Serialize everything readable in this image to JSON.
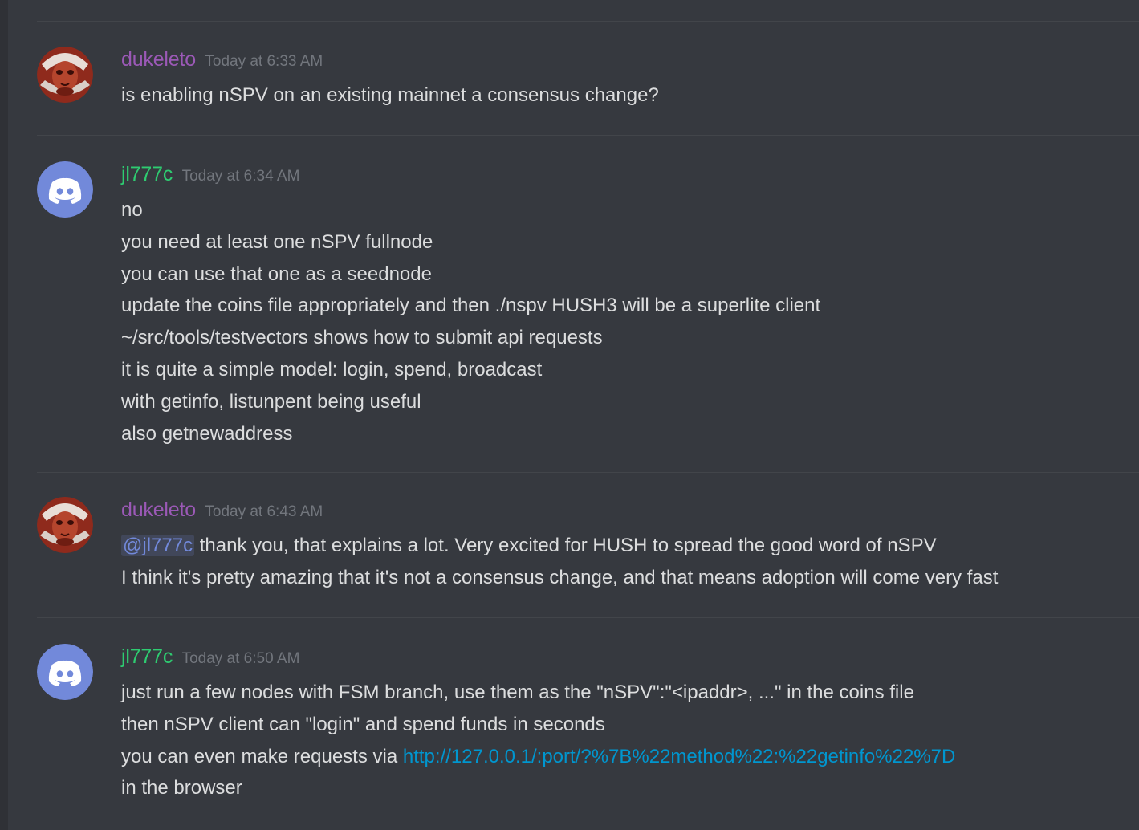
{
  "colors": {
    "background": "#36393f",
    "dukeleto": "#9b59b6",
    "jl777c": "#2ecc71",
    "text": "#dcddde",
    "timestamp": "#72767d",
    "link": "#0096cf",
    "mention": "#7289da",
    "discord_blurple": "#7289da"
  },
  "messages": [
    {
      "author": "dukeleto",
      "avatar": "red-skull-avatar",
      "timestamp": "Today at 6:33 AM",
      "lines": [
        "is enabling nSPV on an existing mainnet a consensus change?"
      ]
    },
    {
      "author": "jl777c",
      "avatar": "discord-logo-icon",
      "timestamp": "Today at 6:34 AM",
      "lines": [
        "no",
        "you need at least one nSPV fullnode",
        "you can use that one as a seednode",
        "update the coins file appropriately and then ./nspv HUSH3 will be a superlite client",
        "~/src/tools/testvectors shows how to submit api requests",
        "it is quite a simple model: login, spend, broadcast",
        "with getinfo, listunpent being useful",
        "also getnewaddress"
      ]
    },
    {
      "author": "dukeleto",
      "avatar": "red-skull-avatar",
      "timestamp": "Today at 6:43 AM",
      "mention": "@jl777c",
      "lines": [
        " thank you, that explains a lot. Very excited for HUSH to spread the good word of nSPV",
        "I think it's pretty amazing that it's not a consensus change, and that means adoption will come very fast"
      ]
    },
    {
      "author": "jl777c",
      "avatar": "discord-logo-icon",
      "timestamp": "Today at 6:50 AM",
      "lines": [
        "just run a few nodes with FSM branch, use them as the \"nSPV\":\"<ipaddr>, ...\" in the coins file",
        "then nSPV client can \"login\" and spend funds in seconds",
        "you can even make requests via ",
        "in the browser"
      ],
      "link": "http://127.0.0.1/:port/?%7B%22method%22:%22getinfo%22%7D"
    }
  ]
}
